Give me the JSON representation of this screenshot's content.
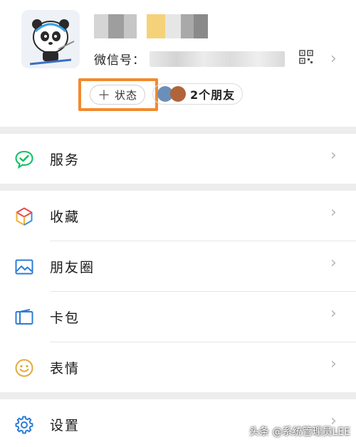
{
  "profile": {
    "wechat_id_label": "微信号：",
    "status_plus": "＋",
    "status_label": "状态",
    "friends_label": "2个朋友"
  },
  "menu": [
    {
      "label": "服务",
      "icon": "service-check-icon"
    },
    {
      "label": "收藏",
      "icon": "favorites-cube-icon"
    },
    {
      "label": "朋友圈",
      "icon": "moments-picture-icon"
    },
    {
      "label": "卡包",
      "icon": "card-wallet-icon"
    },
    {
      "label": "表情",
      "icon": "sticker-smile-icon"
    },
    {
      "label": "设置",
      "icon": "gear-icon"
    }
  ],
  "chevron": "›",
  "watermark": "头条 @系统管理员LEE",
  "colors": {
    "highlight": "#f28a2e",
    "wechat_green": "#07c160",
    "icon_blue": "#2c7cd6",
    "sticker_yellow": "#e6a93a"
  }
}
